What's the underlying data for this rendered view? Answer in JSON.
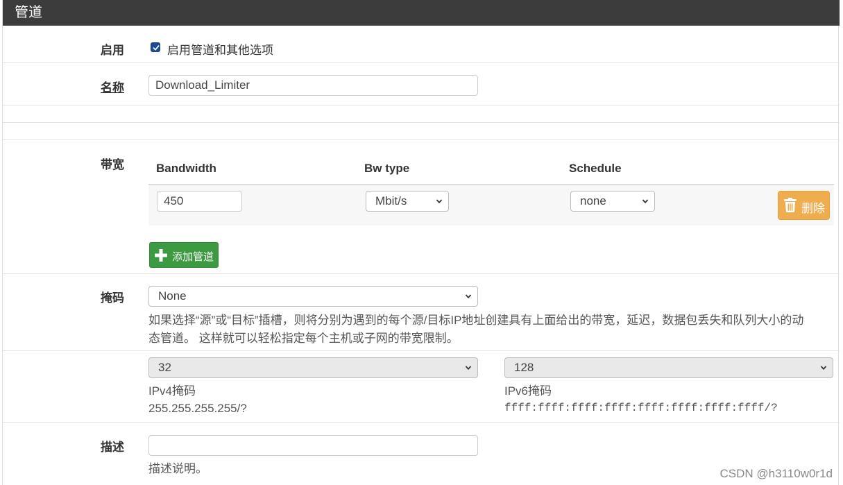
{
  "panel": {
    "title": "管道"
  },
  "enable": {
    "label": "启用",
    "checkbox_label": "启用管道和其他选项",
    "checked": true
  },
  "name": {
    "label": "名称",
    "value": "Download_Limiter"
  },
  "bandwidth": {
    "label": "带宽",
    "columns": [
      "Bandwidth",
      "Bw type",
      "Schedule"
    ],
    "rows": [
      {
        "bandwidth": "450",
        "bw_type": "Mbit/s",
        "schedule": "none",
        "delete_label": "删除"
      }
    ],
    "add_label": "添加管道"
  },
  "mask": {
    "label": "掩码",
    "selected": "None",
    "help_line1": "如果选择“源”或“目标”插槽，则将分别为遇到的每个源/目标IP地址创建具有上面给出的带宽，延迟，数据包丢失和队列大小的动",
    "help_line2": "态管道。 这样就可以轻松指定每个主机或子网的带宽限制。"
  },
  "ipv4": {
    "selected": "32",
    "label": "IPv4掩码",
    "hint": "255.255.255.255/?"
  },
  "ipv6": {
    "selected": "128",
    "label": "IPv6掩码",
    "hint": "ffff:ffff:ffff:ffff:ffff:ffff:ffff:ffff/?"
  },
  "description": {
    "label": "描述",
    "value": "",
    "help": "描述说明。"
  },
  "watermark": "CSDN @h3110w0r1d",
  "colors": {
    "header_bg": "#3c3c3c",
    "delete_button": "#f0ad4e",
    "add_button": "#3c9a41",
    "checkbox": "#1e4a9e"
  }
}
